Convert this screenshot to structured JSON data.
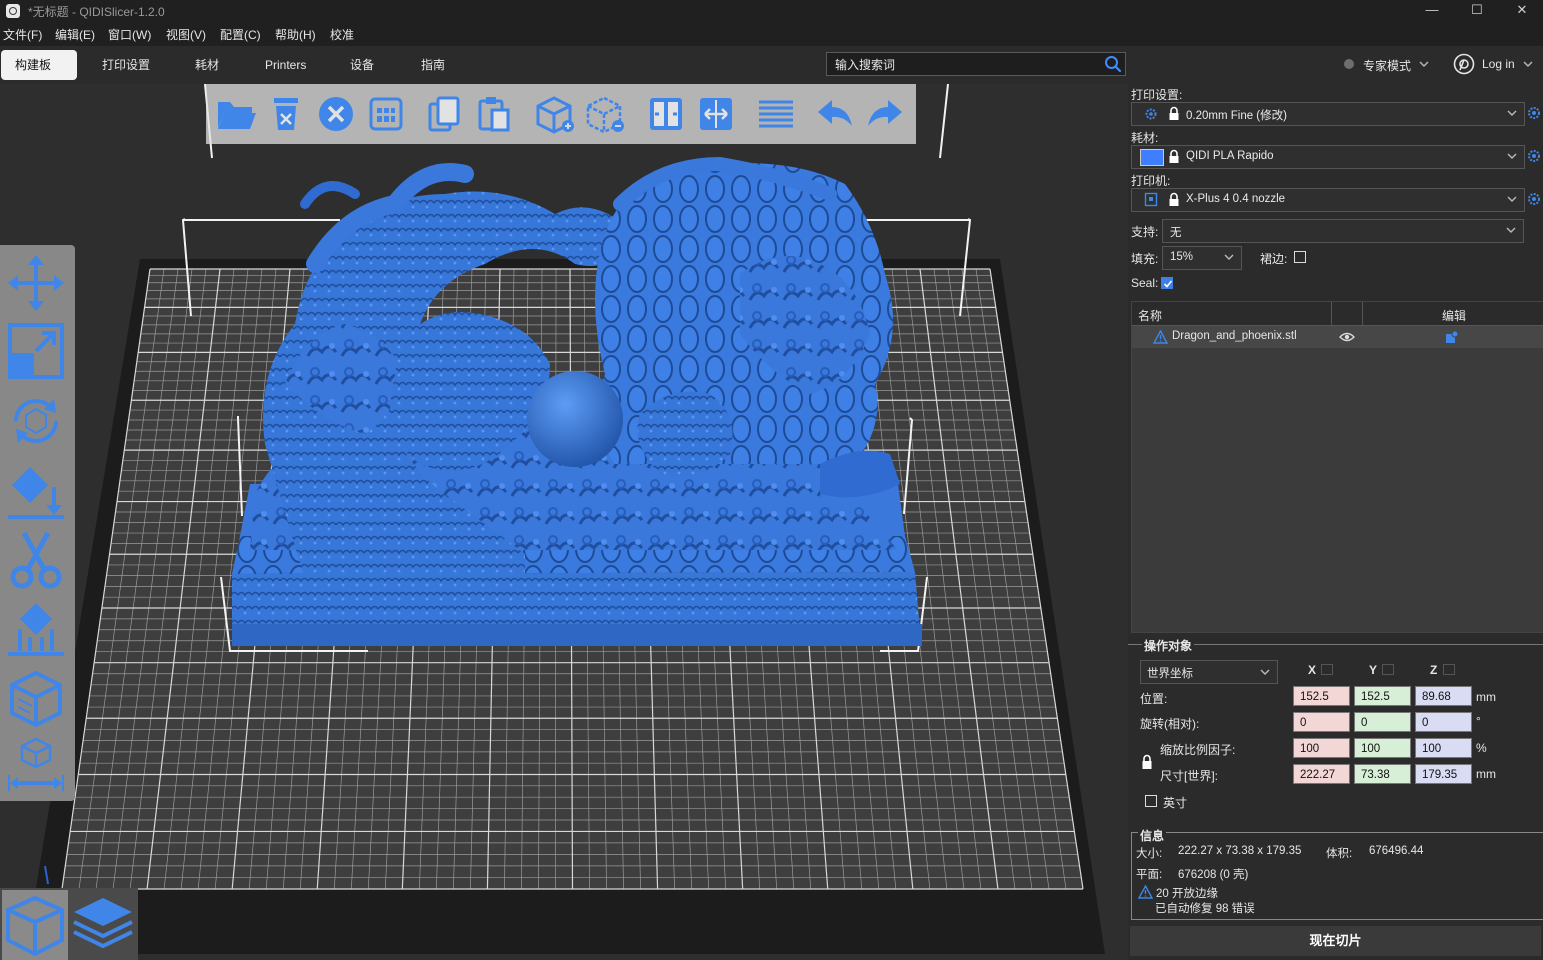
{
  "window": {
    "title": "*无标题 - QIDISlicer-1.2.0",
    "minimize": "—",
    "maximize": "☐",
    "close": "✕"
  },
  "menu": [
    "文件(F)",
    "编辑(E)",
    "窗口(W)",
    "视图(V)",
    "配置(C)",
    "帮助(H)",
    "校准"
  ],
  "tabs": [
    "构建板",
    "打印设置",
    "耗材",
    "Printers",
    "设备",
    "指南"
  ],
  "search": {
    "placeholder": "输入搜索词"
  },
  "mode": {
    "label": "专家模式"
  },
  "login": {
    "label": "Log in"
  },
  "print_settings": {
    "label": "打印设置:",
    "value": "0.20mm Fine (修改)"
  },
  "filament": {
    "label": "耗材:",
    "value": "QIDI PLA Rapido",
    "color": "#3f7fff"
  },
  "printer": {
    "label": "打印机:",
    "value": "X-Plus 4 0.4 nozzle"
  },
  "support": {
    "label": "支持:",
    "value": "无"
  },
  "infill": {
    "label": "填充:",
    "value": "15%"
  },
  "brim": {
    "label": "裙边:"
  },
  "seal": {
    "label": "Seal:"
  },
  "object_list": {
    "col_name": "名称",
    "col_edit": "编辑",
    "items": [
      {
        "name": "Dragon_and_phoenix.stl"
      }
    ]
  },
  "manipulation": {
    "title": "操作对象",
    "coord_system": "世界坐标",
    "axes": [
      "X",
      "Y",
      "Z"
    ],
    "rows": [
      {
        "label": "位置:",
        "values": [
          "152.5",
          "152.5",
          "89.68"
        ],
        "unit": "mm"
      },
      {
        "label": "旋转(相对):",
        "values": [
          "0",
          "0",
          "0"
        ],
        "unit": "°"
      },
      {
        "label": "缩放比例因子:",
        "values": [
          "100",
          "100",
          "100"
        ],
        "unit": "%"
      },
      {
        "label": "尺寸[世界]:",
        "values": [
          "222.27",
          "73.38",
          "179.35"
        ],
        "unit": "mm"
      }
    ],
    "inches_label": "英寸"
  },
  "info": {
    "title": "信息",
    "size_label": "大小:",
    "size_value": "222.27 x 73.38 x 179.35",
    "volume_label": "体积:",
    "volume_value": "676496.44",
    "facets_label": "平面:",
    "facets_value": "676208 (0 壳)",
    "warning": "20 开放边缘",
    "repaired": "已自动修复 98 错误"
  },
  "slice_button": "现在切片",
  "colors": {
    "accent": "#3f7fff",
    "background": "#2b2b2b",
    "model": "#3a78dc"
  },
  "toolbar_icons": [
    "open-folder-icon",
    "delete-icon",
    "delete-all-icon",
    "arrange-icon",
    "copy-icon",
    "paste-icon",
    "add-instance-icon",
    "remove-instance-icon",
    "split-objects-icon",
    "split-parts-icon",
    "layers-editing-icon",
    "undo-icon",
    "redo-icon"
  ],
  "left_toolbar_icons": [
    "move-icon",
    "scale-icon",
    "rotate-icon",
    "place-on-face-icon",
    "cut-icon",
    "support-paint-icon",
    "seam-paint-icon",
    "measure-icon"
  ]
}
